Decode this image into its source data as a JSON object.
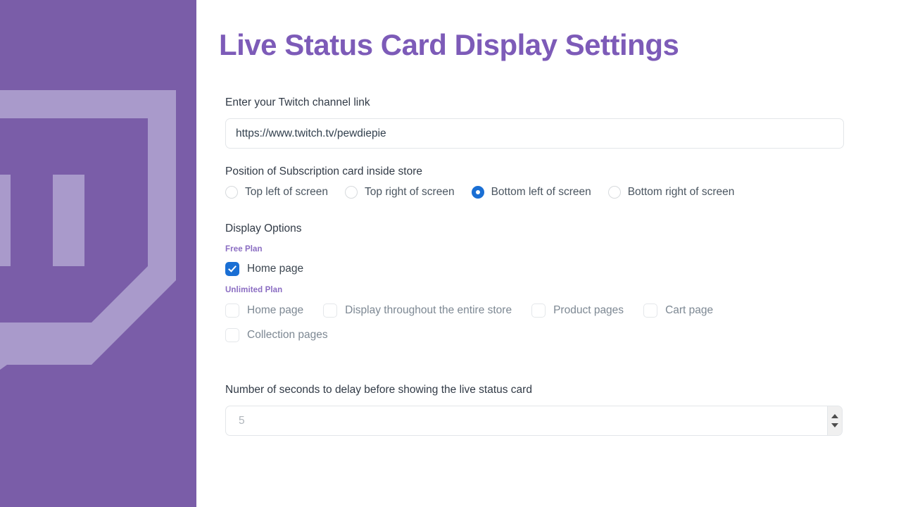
{
  "brand": {
    "logo_icon": "twitch-glitch-logo",
    "panel_color": "#7a5da8",
    "logo_color": "#a99acb"
  },
  "header": {
    "title": "Live Status Card Display Settings",
    "title_color": "#7d5bb8"
  },
  "channel": {
    "label": "Enter your Twitch channel link",
    "value": "https://www.twitch.tv/pewdiepie",
    "placeholder": "https://www.twitch.tv/"
  },
  "position": {
    "label": "Position of Subscription card inside store",
    "selected": "Bottom left of screen",
    "options": [
      {
        "label": "Top left of screen",
        "selected": false
      },
      {
        "label": "Top right of screen",
        "selected": false
      },
      {
        "label": "Bottom left of screen",
        "selected": true
      },
      {
        "label": "Bottom right of screen",
        "selected": false
      }
    ]
  },
  "display_options": {
    "title": "Display Options",
    "free_plan_label": "Free Plan",
    "unlimited_plan_label": "Unlimited Plan",
    "plan_label_color": "#8a6cc2",
    "accent_color": "#1a6fd4",
    "free_plan_options": [
      {
        "label": "Home page",
        "checked": true,
        "disabled": false
      }
    ],
    "unlimited_plan_options": [
      {
        "label": "Home page",
        "checked": false,
        "disabled": true
      },
      {
        "label": "Display throughout the entire store",
        "checked": false,
        "disabled": true
      },
      {
        "label": "Product pages",
        "checked": false,
        "disabled": true
      },
      {
        "label": "Cart page",
        "checked": false,
        "disabled": true
      },
      {
        "label": "Collection pages",
        "checked": false,
        "disabled": true
      }
    ]
  },
  "delay": {
    "label": "Number of seconds to delay before showing the live status card",
    "value": "",
    "placeholder": "5",
    "spinner_up_icon": "triangle-up-icon",
    "spinner_down_icon": "triangle-down-icon"
  }
}
